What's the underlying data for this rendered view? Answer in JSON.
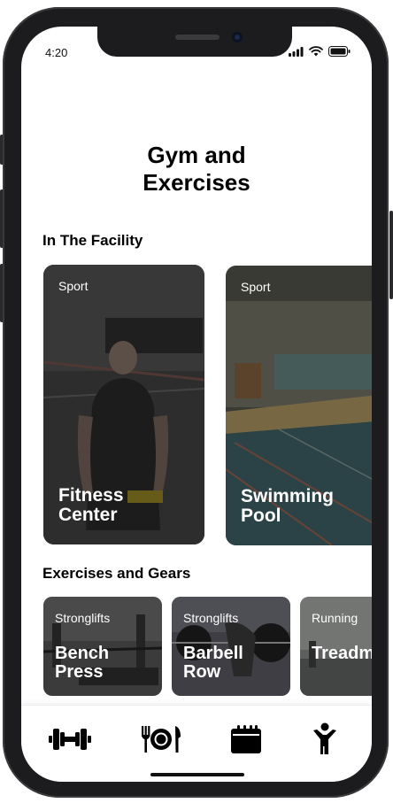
{
  "status_bar": {
    "time": "4:20"
  },
  "header": {
    "title_line1": "Gym and",
    "title_line2": "Exercises"
  },
  "facility": {
    "title": "In The Facility",
    "cards": [
      {
        "tag": "Sport",
        "name_line1": "Fitness",
        "name_line2": "Center"
      },
      {
        "tag": "Sport",
        "name_line1": "Swimming",
        "name_line2": "Pool"
      }
    ]
  },
  "exercises": {
    "title": "Exercises and Gears",
    "cards": [
      {
        "tag": "Stronglifts",
        "name_line1": "Bench",
        "name_line2": "Press"
      },
      {
        "tag": "Stronglifts",
        "name_line1": "Barbell",
        "name_line2": "Row"
      },
      {
        "tag": "Running",
        "name_line1": "",
        "name_line2": "Treadmill"
      }
    ]
  },
  "colors": {
    "accent": "#000000",
    "card_overlay": "#3a3a3a",
    "background": "#ffffff"
  },
  "tabbar": {
    "icons": [
      "dumbbell-icon",
      "dining-icon",
      "calendar-icon",
      "person-icon"
    ]
  }
}
